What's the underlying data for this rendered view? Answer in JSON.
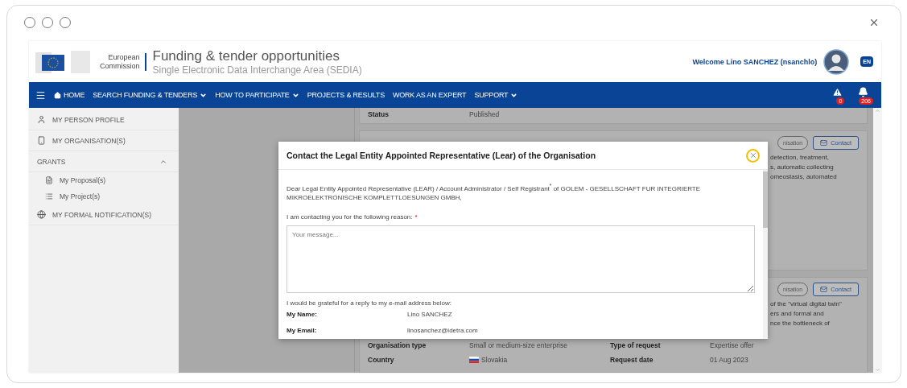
{
  "header": {
    "logo_line1": "European",
    "logo_line2": "Commission",
    "title": "Funding & tender opportunities",
    "subtitle": "Single Electronic Data Interchange Area (SEDIA)",
    "welcome": "Welcome Lino SANCHEZ (nsanchlo)",
    "language": "EN"
  },
  "nav": {
    "items": [
      {
        "label": "HOME",
        "kind": "home"
      },
      {
        "label": "SEARCH FUNDING & TENDERS",
        "kind": "dropdown"
      },
      {
        "label": "HOW TO PARTICIPATE",
        "kind": "dropdown"
      },
      {
        "label": "PROJECTS & RESULTS",
        "kind": "link"
      },
      {
        "label": "WORK AS AN EXPERT",
        "kind": "link"
      },
      {
        "label": "SUPPORT",
        "kind": "dropdown"
      }
    ],
    "alerts": [
      {
        "kind": "warning",
        "count": "0"
      },
      {
        "kind": "bell",
        "count": "206"
      }
    ]
  },
  "sidebar": {
    "items": [
      {
        "label": "MY PERSON PROFILE",
        "kind": "profile"
      },
      {
        "label": "MY ORGANISATION(S)",
        "kind": "organisation"
      },
      {
        "label": "GRANTS",
        "kind": "group",
        "expanded": true,
        "children": [
          {
            "label": "My Proposal(s)",
            "kind": "proposal"
          },
          {
            "label": "My Project(s)",
            "kind": "project"
          }
        ]
      },
      {
        "label": "MY FORMAL NOTIFICATION(S)",
        "kind": "notification"
      }
    ]
  },
  "cards": [
    {
      "fields": [
        {
          "label": "Status",
          "value": "Published"
        }
      ]
    },
    {
      "buttons": [
        "nisation",
        "Contact"
      ],
      "text_lines": [
        "detection, treatment,",
        "s, automatic collecting",
        "omeostasis, automated"
      ]
    },
    {
      "buttons": [
        "nisation",
        "Contact"
      ],
      "text_lines": [
        "of the \"virtual digital twin\"",
        "ers and formal and",
        "nce the bottleneck of"
      ],
      "rows": [
        [
          "Organisation type",
          "Small or medium-size enterprise",
          "Type of request",
          "Expertise offer"
        ],
        [
          "Country",
          "Slovakia",
          "Request date",
          "01 Aug 2023"
        ]
      ]
    }
  ],
  "modal": {
    "title": "Contact the Legal Entity Appointed Representative (Lear) of the Organisation",
    "greeting": "Dear Legal Entity Appointed Representative (LEAR) / Account Administrator / Self Registrant$^{*}$ of GOLEM - GESELLSCHAFT FUR INTEGRIERTE MIKROELEKTRONISCHE KOMPLETTLOESUNGEN GMBH,",
    "reason_label": "I am contacting you for the following reason:",
    "required": "*",
    "message": {
      "placeholder": "Your message..."
    },
    "reply_note": "I would be grateful for a reply to my e-mail address below:",
    "details": [
      {
        "label": "My Name:",
        "value": "Lino SANCHEZ"
      },
      {
        "label": "My Email:",
        "value": "linosanchez@idetra.com"
      }
    ]
  }
}
